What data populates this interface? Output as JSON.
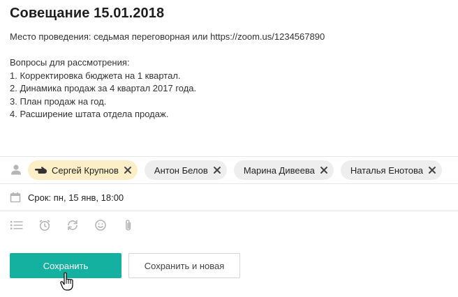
{
  "task": {
    "title": "Совещание 15.01.2018",
    "description_lines": [
      "Место проведения: седьмая переговорная или https://zoom.us/1234567890",
      "",
      "Вопросы для рассмотрения:",
      "1. Корректировка бюджета на 1 квартал.",
      "2. Динамика продаж за 4 квартал 2017 года.",
      "3. План продаж на год.",
      "4. Расширение штата отдела продаж."
    ]
  },
  "participants": [
    {
      "name": "Сергей Крупнов",
      "role": "owner"
    },
    {
      "name": "Антон Белов",
      "role": "member"
    },
    {
      "name": "Марина Дивеева",
      "role": "member"
    },
    {
      "name": "Наталья Енотова",
      "role": "member"
    }
  ],
  "deadline": {
    "label": "Срок: пн, 15 янв, 18:00"
  },
  "toolbar_icons": [
    "checklist-icon",
    "alarm-icon",
    "repeat-icon",
    "smiley-icon",
    "paperclip-icon"
  ],
  "actions": {
    "save_label": "Сохранить",
    "save_new_label": "Сохранить и новая"
  },
  "colors": {
    "primary": "#14b1a0",
    "owner_chip": "#fcefc7",
    "chip": "#eeeeee",
    "icon": "#b5b5b5"
  }
}
